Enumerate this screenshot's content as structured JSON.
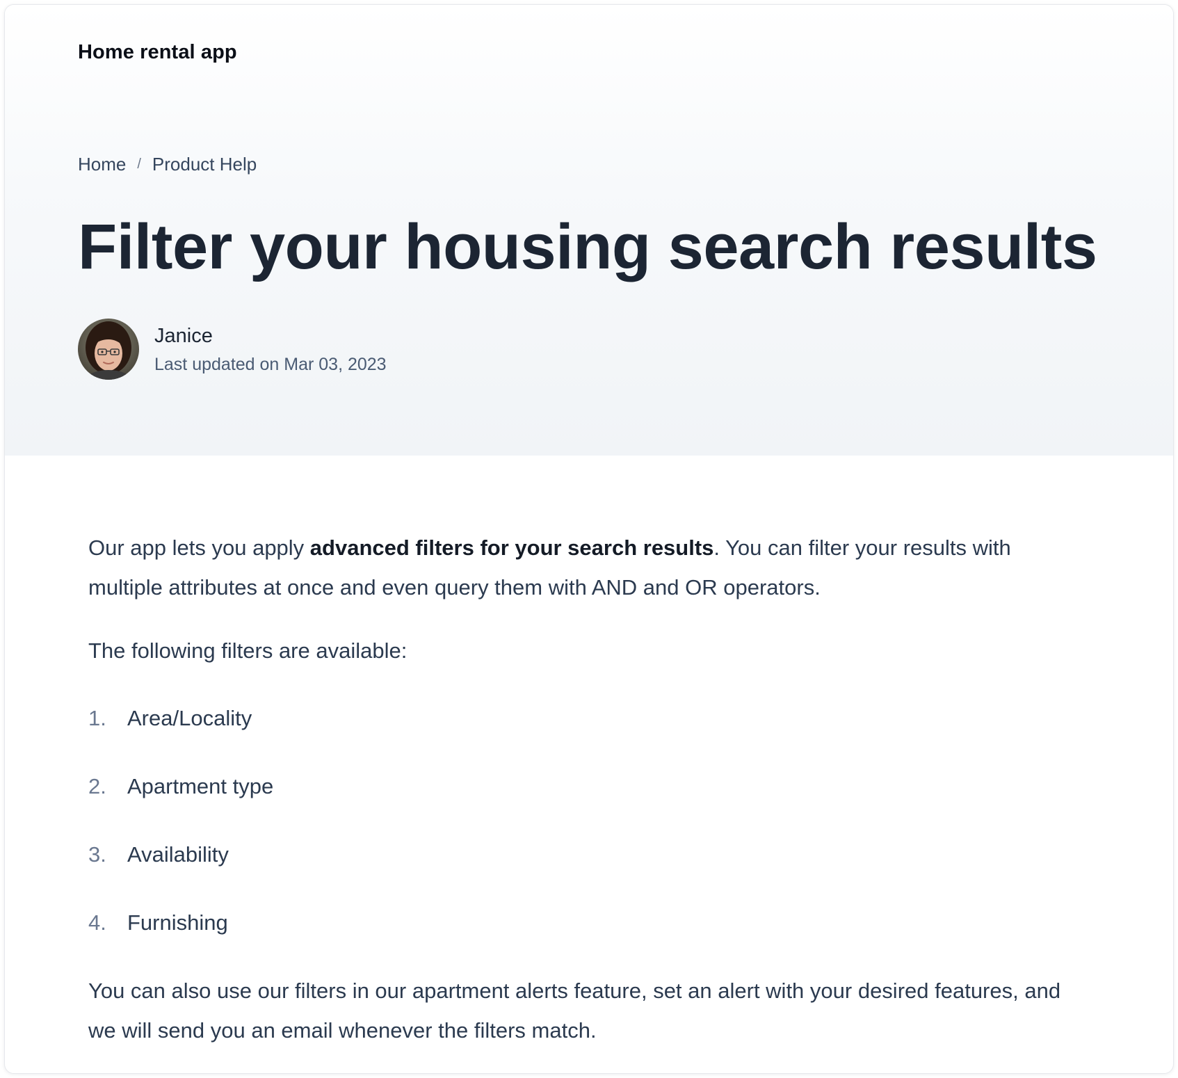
{
  "header": {
    "brand": "Home rental app"
  },
  "breadcrumb": {
    "items": [
      "Home",
      "Product Help"
    ],
    "separator": "/"
  },
  "article": {
    "title": "Filter your housing search results",
    "author": {
      "name": "Janice",
      "updated": "Last updated on Mar 03, 2023",
      "avatar_icon": "avatar-photo"
    },
    "intro": {
      "before": "Our app lets you apply ",
      "bold": "advanced filters for your search results",
      "after": ". You can filter your results with multiple attributes at once and even query them with AND and OR operators."
    },
    "lead": "The following filters are available:",
    "filters": [
      {
        "num": "1.",
        "label": "Area/Locality"
      },
      {
        "num": "2.",
        "label": "Apartment type"
      },
      {
        "num": "3.",
        "label": "Availability"
      },
      {
        "num": "4.",
        "label": "Furnishing"
      }
    ],
    "outro": "You can also use our filters in our apartment alerts feature, set an alert with your desired features, and we will send you an email whenever the filters match."
  },
  "colors": {
    "title": "#1c2533",
    "body_text": "#2b3a4f",
    "muted": "#4a5b73",
    "hero_bg_bottom": "#f1f4f7"
  }
}
